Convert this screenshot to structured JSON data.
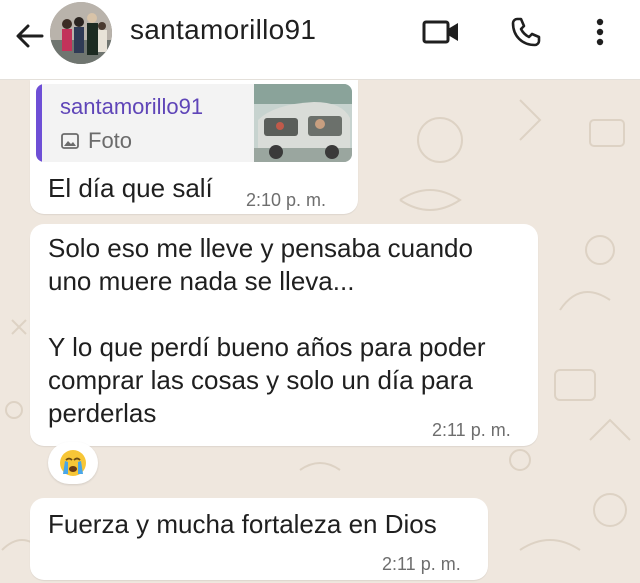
{
  "header": {
    "contact_name": "santamorillo91"
  },
  "messages": [
    {
      "quote": {
        "author": "santamorillo91",
        "type_label": "Foto"
      },
      "text": "El día que salí",
      "time": "2:10 p. m."
    },
    {
      "lines": [
        "Solo eso me lleve y pensaba cuando",
        "uno muere nada se lleva...",
        "",
        "Y lo que perdí bueno años para poder",
        "comprar las cosas y solo un día para",
        "perderlas"
      ],
      "time": "2:11 p. m.",
      "reaction": "crying-face-emoji"
    },
    {
      "text": "Fuerza y mucha fortaleza en Dios",
      "time": "2:11 p. m."
    }
  ],
  "colors": {
    "header_bg": "#ffffff",
    "chat_bg": "#efe7de",
    "bubble_bg": "#ffffff",
    "quote_bar": "#6e4fd6",
    "quote_author": "#5f45b8"
  }
}
